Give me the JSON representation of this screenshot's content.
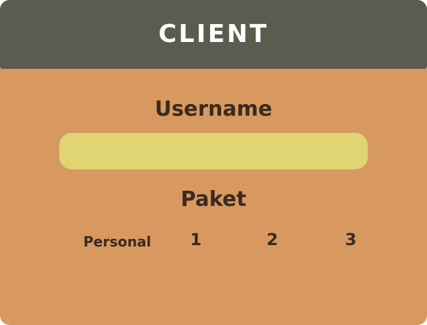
{
  "header": {
    "logo_text": "CLIENT",
    "background_color": "#5c5b50"
  },
  "form": {
    "username_label": "Username",
    "username_value": "",
    "paket_label": "Paket",
    "paket_options": [
      "Personal",
      "1",
      "2",
      "3"
    ]
  },
  "colors": {
    "panel_background": "#d7995f",
    "input_background": "#e0d473",
    "text": "#3b2a20",
    "logo_text": "#ffffff"
  }
}
